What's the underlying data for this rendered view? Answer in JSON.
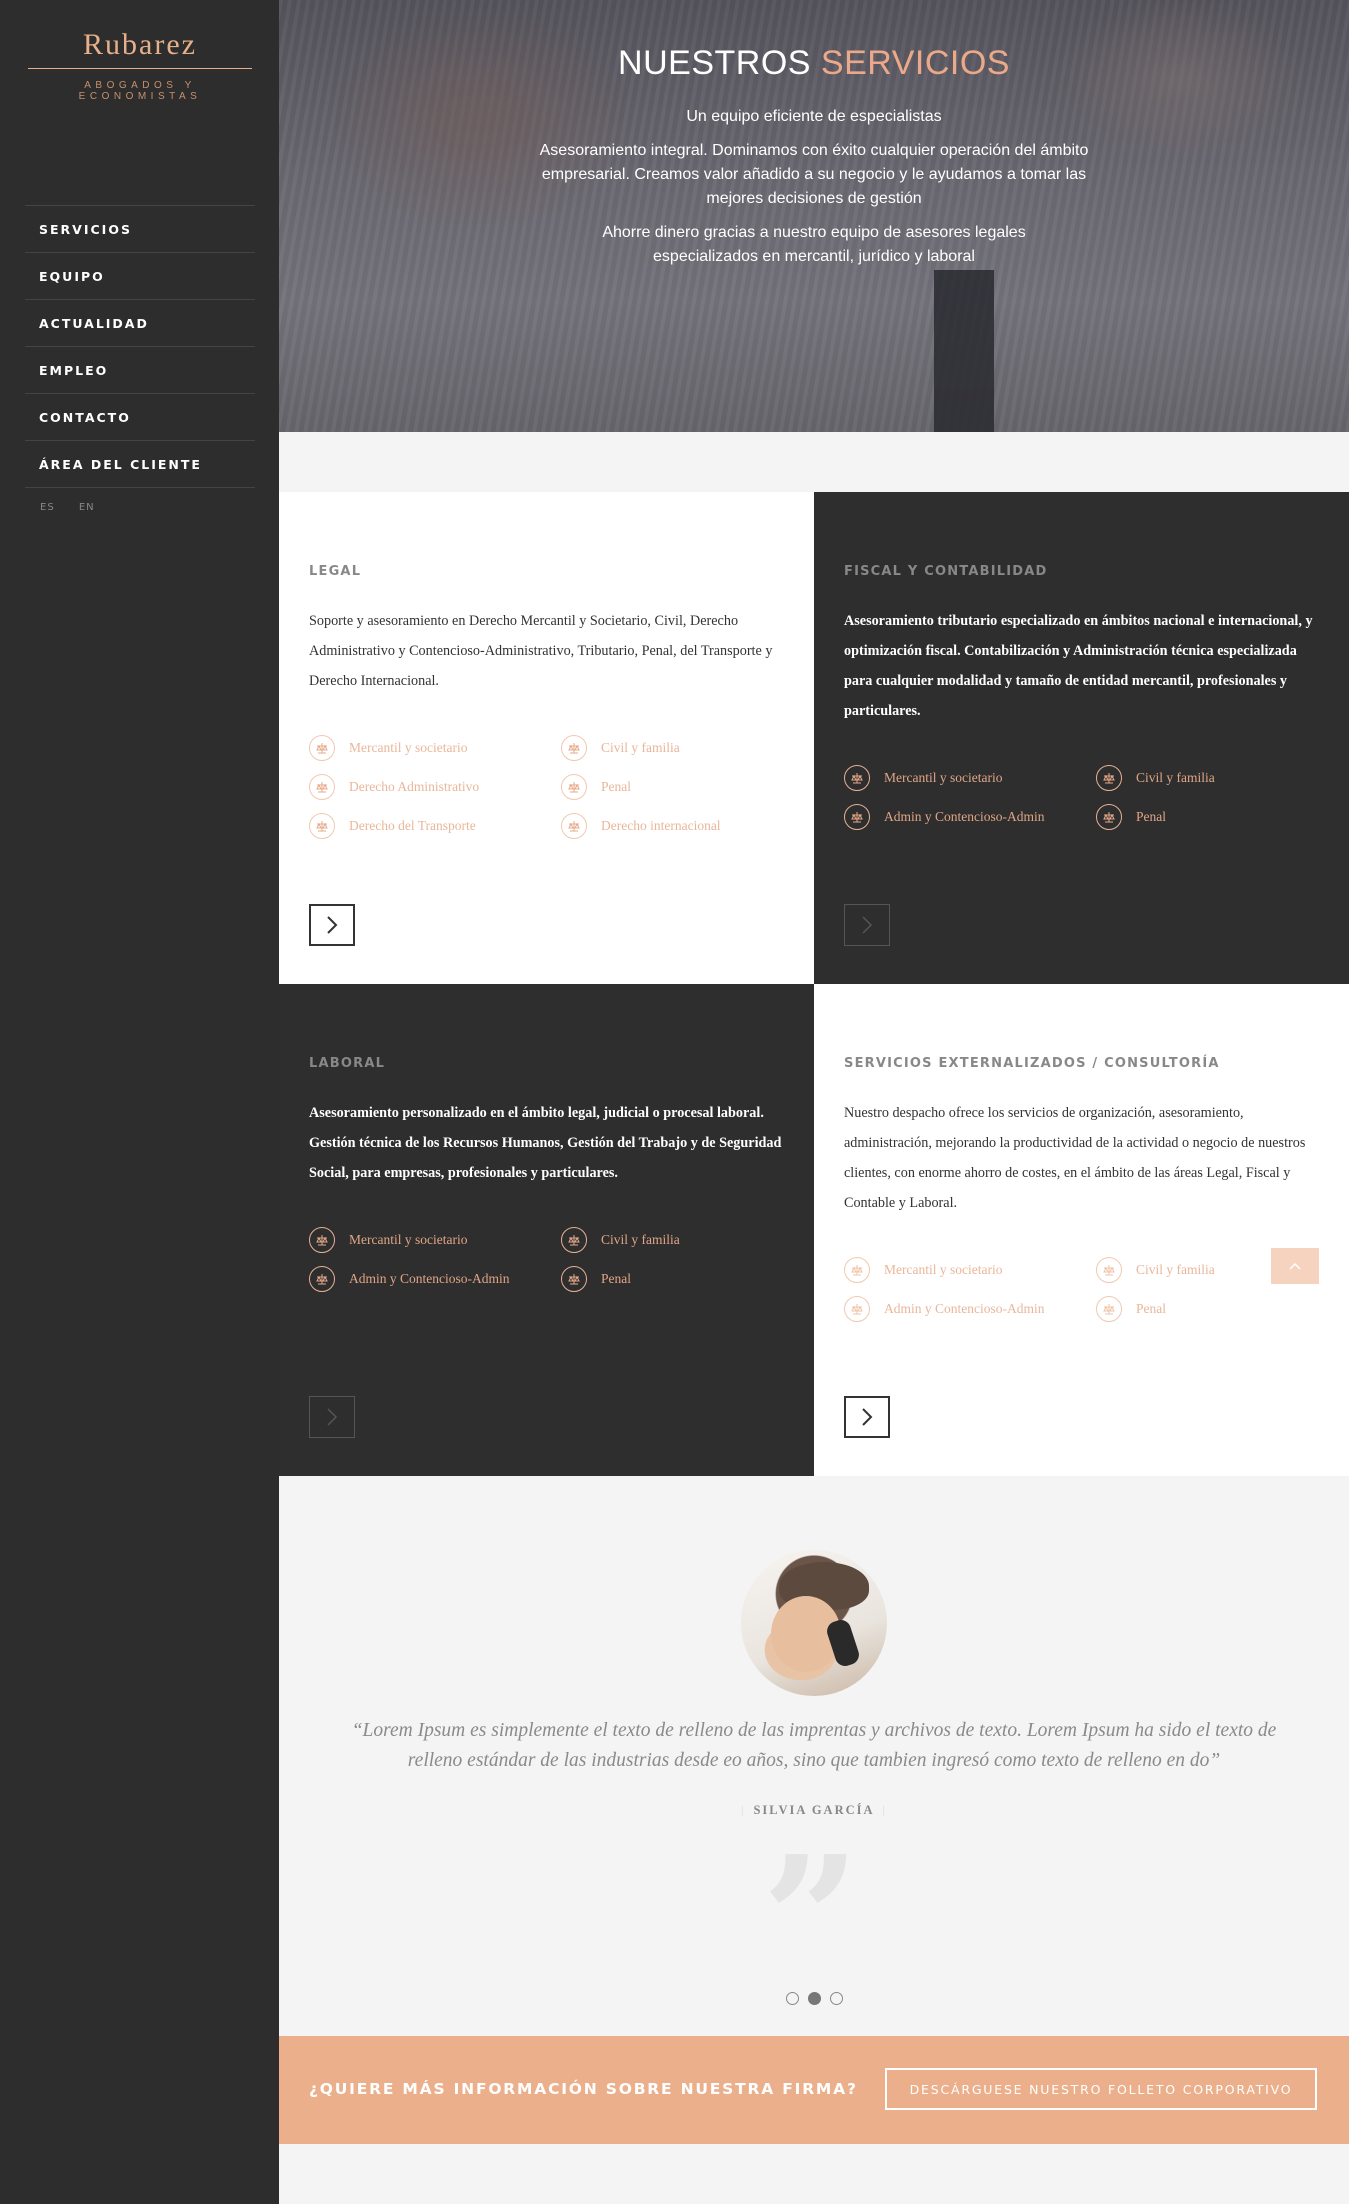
{
  "brand": {
    "name": "Rubarez",
    "tagline": "ABOGADOS Y ECONOMISTAS",
    "accent_color": "#e8b08a",
    "sidebar_color": "#2d2d2e"
  },
  "nav": {
    "items": [
      "SERVICIOS",
      "EQUIPO",
      "ACTUALIDAD",
      "EMPLEO",
      "CONTACTO",
      "ÁREA DEL CLIENTE"
    ],
    "languages": [
      "ES",
      "EN"
    ]
  },
  "hero": {
    "title_main": "NUESTROS",
    "title_accent": "SERVICIOS",
    "subtitle": "Un equipo eficiente de especialistas",
    "paragraph1": "Asesoramiento integral. Dominamos con éxito cualquier operación del ámbito empresarial. Creamos valor añadido a su negocio y le ayudamos a tomar las mejores decisiones de gestión",
    "paragraph2": "Ahorre dinero gracias a nuestro equipo de asesores legales especializados en mercantil, jurídico y laboral"
  },
  "services": [
    {
      "title": "LEGAL",
      "description": "Soporte y asesoramiento en Derecho Mercantil y Societario, Civil, Derecho Administrativo y Contencioso-Administrativo, Tributario, Penal, del Transporte y Derecho Internacional.",
      "links": [
        "Mercantil y societario",
        "Civil y familia",
        "Derecho Administrativo",
        "Penal",
        "Derecho del Transporte",
        "Derecho internacional"
      ]
    },
    {
      "title": "FISCAL Y CONTABILIDAD",
      "description": "Asesoramiento tributario especializado en ámbitos nacional e internacional, y optimización fiscal. Contabilización y Administración técnica especializada para cualquier modalidad y tamaño de entidad mercantil, profesionales y particulares.",
      "links": [
        "Mercantil y societario",
        "Civil y familia",
        "Admin y Contencioso-Admin",
        "Penal"
      ]
    },
    {
      "title": "LABORAL",
      "description": "Asesoramiento personalizado en el ámbito legal, judicial o procesal laboral. Gestión técnica de los Recursos Humanos, Gestión del Trabajo y de Seguridad Social, para empresas, profesionales y particulares.",
      "links": [
        "Mercantil y societario",
        "Civil y familia",
        "Admin y Contencioso-Admin",
        "Penal"
      ]
    },
    {
      "title": "SERVICIOS EXTERNALIZADOS / CONSULTORÍA",
      "description": "Nuestro despacho ofrece los servicios de organización, asesoramiento, administración, mejorando la productividad de la actividad o negocio de nuestros clientes, con enorme ahorro de costes, en el ámbito de las áreas Legal, Fiscal y Contable y Laboral.",
      "links": [
        "Mercantil y societario",
        "Civil y familia",
        "Admin y Contencioso-Admin",
        "Penal"
      ]
    }
  ],
  "testimonial": {
    "quote": "“Lorem Ipsum es simplemente el texto de relleno de las imprentas y archivos de texto. Lorem Ipsum ha sido el texto de relleno estándar de las industrias desde eo años, sino que tambien ingresó como texto de relleno en do”",
    "author": "SILVIA GARCÍA",
    "quote_mark": "”",
    "slides": 3,
    "active_slide": 2
  },
  "cta": {
    "text": "¿QUIERE MÁS INFORMACIÓN SOBRE NUESTRA FIRMA?",
    "button": "DESCÁRGUESE NUESTRO FOLLETO CORPORATIVO",
    "color": "#ebb08b"
  }
}
